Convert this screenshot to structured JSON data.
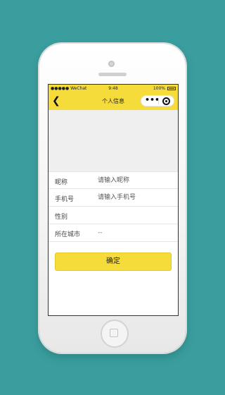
{
  "status_bar": {
    "carrier": "●●●●● WeChat",
    "time": "9:48",
    "battery_text": "100%"
  },
  "nav_bar": {
    "back_glyph": "❮",
    "title": "个人信息",
    "menu_glyph": "•••"
  },
  "form": {
    "nickname": {
      "label": "昵称",
      "placeholder": "请输入昵称"
    },
    "phone": {
      "label": "手机号",
      "placeholder": "请输入手机号"
    },
    "gender": {
      "label": "性别",
      "value": ""
    },
    "city": {
      "label": "所在城市",
      "value": "--"
    }
  },
  "submit_button": {
    "label": "确定"
  },
  "colors": {
    "accent": "#f6dc3a",
    "background": "#3a9e9e"
  }
}
